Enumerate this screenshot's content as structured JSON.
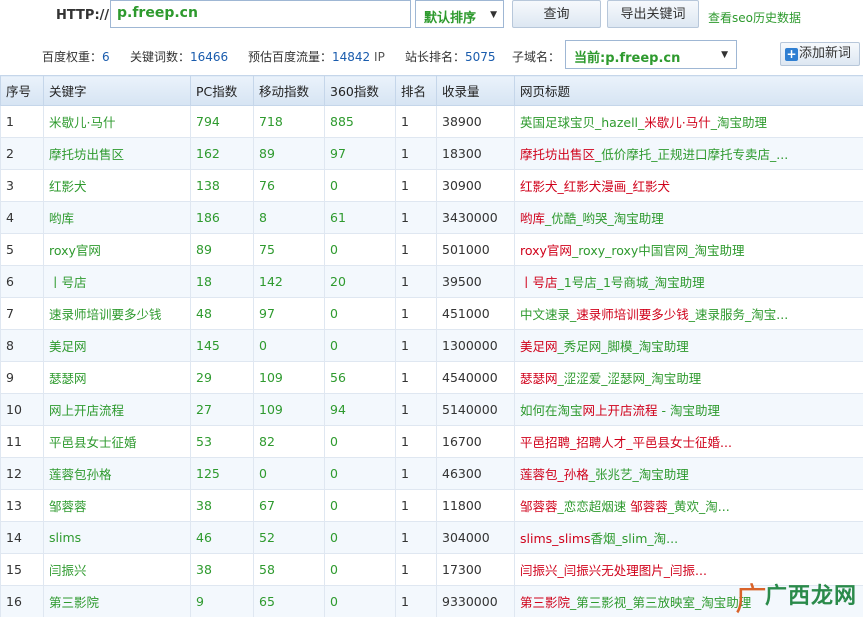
{
  "toolbar": {
    "http_label": "HTTP://",
    "url_value": "p.freep.cn",
    "sort_value": "默认排序",
    "query_label": "查询",
    "export_label": "导出关键词",
    "history_link": "查看seo历史数据"
  },
  "stats": {
    "baidu_weight_label": "百度权重：",
    "baidu_weight_value": "6",
    "keyword_count_label": "关键词数：",
    "keyword_count_value": "16466",
    "traffic_label": "预估百度流量：",
    "traffic_value": "14842",
    "traffic_unit": "IP",
    "rank_label": "站长排名：",
    "rank_value": "5075",
    "subdomain_label": "子域名：",
    "subdomain_value": "当前:p.freep.cn",
    "add_keyword_label": "添加新词"
  },
  "table": {
    "headers": [
      "序号",
      "关键字",
      "PC指数",
      "移动指数",
      "360指数",
      "排名",
      "收录量",
      "网页标题"
    ],
    "rows": [
      {
        "idx": "1",
        "kw": "米歇儿·马什",
        "pc": "794",
        "mobile": "718",
        "s360": "885",
        "rank": "1",
        "indexed": "38900",
        "title_parts": [
          {
            "t": "英国足球宝贝_hazell_",
            "h": false
          },
          {
            "t": "米歇儿·马什",
            "h": true
          },
          {
            "t": "_淘宝助理",
            "h": false
          }
        ]
      },
      {
        "idx": "2",
        "kw": "摩托坊出售区",
        "pc": "162",
        "mobile": "89",
        "s360": "97",
        "rank": "1",
        "indexed": "18300",
        "title_parts": [
          {
            "t": "摩托坊出售区",
            "h": true
          },
          {
            "t": "_低价摩托_正规进口摩托专卖店_...",
            "h": false
          }
        ]
      },
      {
        "idx": "3",
        "kw": "红影犬",
        "pc": "138",
        "mobile": "76",
        "s360": "0",
        "rank": "1",
        "indexed": "30900",
        "title_parts": [
          {
            "t": "红影犬_红影犬漫画_红影犬",
            "h": true
          }
        ]
      },
      {
        "idx": "4",
        "kw": "哟库",
        "pc": "186",
        "mobile": "8",
        "s360": "61",
        "rank": "1",
        "indexed": "3430000",
        "title_parts": [
          {
            "t": "哟库",
            "h": true
          },
          {
            "t": "_优酷_哟哭_淘宝助理",
            "h": false
          }
        ]
      },
      {
        "idx": "5",
        "kw": "roxy官网",
        "pc": "89",
        "mobile": "75",
        "s360": "0",
        "rank": "1",
        "indexed": "501000",
        "title_parts": [
          {
            "t": "roxy官网",
            "h": true
          },
          {
            "t": "_roxy_roxy中国官网_淘宝助理",
            "h": false
          }
        ]
      },
      {
        "idx": "6",
        "kw": "丨号店",
        "pc": "18",
        "mobile": "142",
        "s360": "20",
        "rank": "1",
        "indexed": "39500",
        "title_parts": [
          {
            "t": "丨号店",
            "h": true
          },
          {
            "t": "_1号店_1号商城_淘宝助理",
            "h": false
          }
        ]
      },
      {
        "idx": "7",
        "kw": "速录师培训要多少钱",
        "pc": "48",
        "mobile": "97",
        "s360": "0",
        "rank": "1",
        "indexed": "451000",
        "title_parts": [
          {
            "t": "中文速录_",
            "h": false
          },
          {
            "t": "速录师培训要多少钱",
            "h": true
          },
          {
            "t": "_速录服务_淘宝...",
            "h": false
          }
        ]
      },
      {
        "idx": "8",
        "kw": "美足网",
        "pc": "145",
        "mobile": "0",
        "s360": "0",
        "rank": "1",
        "indexed": "1300000",
        "title_parts": [
          {
            "t": "美足网",
            "h": true
          },
          {
            "t": "_秀足网_脚模_淘宝助理",
            "h": false
          }
        ]
      },
      {
        "idx": "9",
        "kw": "瑟瑟网",
        "pc": "29",
        "mobile": "109",
        "s360": "56",
        "rank": "1",
        "indexed": "4540000",
        "title_parts": [
          {
            "t": "瑟瑟网",
            "h": true
          },
          {
            "t": "_涩涩爱_涩瑟网_淘宝助理",
            "h": false
          }
        ]
      },
      {
        "idx": "10",
        "kw": "网上开店流程",
        "pc": "27",
        "mobile": "109",
        "s360": "94",
        "rank": "1",
        "indexed": "5140000",
        "title_parts": [
          {
            "t": "如何在淘宝",
            "h": false
          },
          {
            "t": "网上开店流程",
            "h": true
          },
          {
            "t": " - 淘宝助理",
            "h": false
          }
        ]
      },
      {
        "idx": "11",
        "kw": "平邑县女士征婚",
        "pc": "53",
        "mobile": "82",
        "s360": "0",
        "rank": "1",
        "indexed": "16700",
        "title_parts": [
          {
            "t": "平邑招聘_招聘人才_",
            "h": true
          },
          {
            "t": "平邑县女士征婚...",
            "h": true
          }
        ]
      },
      {
        "idx": "12",
        "kw": "莲蓉包孙格",
        "pc": "125",
        "mobile": "0",
        "s360": "0",
        "rank": "1",
        "indexed": "46300",
        "title_parts": [
          {
            "t": "莲蓉包_孙格",
            "h": true
          },
          {
            "t": "_张兆艺_淘宝助理",
            "h": false
          }
        ]
      },
      {
        "idx": "13",
        "kw": "邹蓉蓉",
        "pc": "38",
        "mobile": "67",
        "s360": "0",
        "rank": "1",
        "indexed": "11800",
        "title_parts": [
          {
            "t": "邹蓉蓉",
            "h": true
          },
          {
            "t": "_恋恋超烟速 ",
            "h": false
          },
          {
            "t": "邹蓉蓉",
            "h": true
          },
          {
            "t": "_黄欢_淘...",
            "h": false
          }
        ]
      },
      {
        "idx": "14",
        "kw": "slims",
        "pc": "46",
        "mobile": "52",
        "s360": "0",
        "rank": "1",
        "indexed": "304000",
        "title_parts": [
          {
            "t": "slims_slims",
            "h": true
          },
          {
            "t": "香烟_slim_淘...",
            "h": false
          }
        ]
      },
      {
        "idx": "15",
        "kw": "闫振兴",
        "pc": "38",
        "mobile": "58",
        "s360": "0",
        "rank": "1",
        "indexed": "17300",
        "title_parts": [
          {
            "t": "闫振兴_闫振兴无处理图片_闫振...",
            "h": true
          }
        ]
      },
      {
        "idx": "16",
        "kw": "第三影院",
        "pc": "9",
        "mobile": "65",
        "s360": "0",
        "rank": "1",
        "indexed": "9330000",
        "title_parts": [
          {
            "t": "第三影院",
            "h": true
          },
          {
            "t": "_第三影视_第三放映室_淘宝助理",
            "h": false
          }
        ]
      }
    ]
  },
  "watermark": {
    "text": "广西龙网"
  },
  "colors": {
    "green": "#2e9a2e",
    "red": "#d0021b",
    "blue": "#1a5cad",
    "header_bg": "#d6e4f3"
  }
}
